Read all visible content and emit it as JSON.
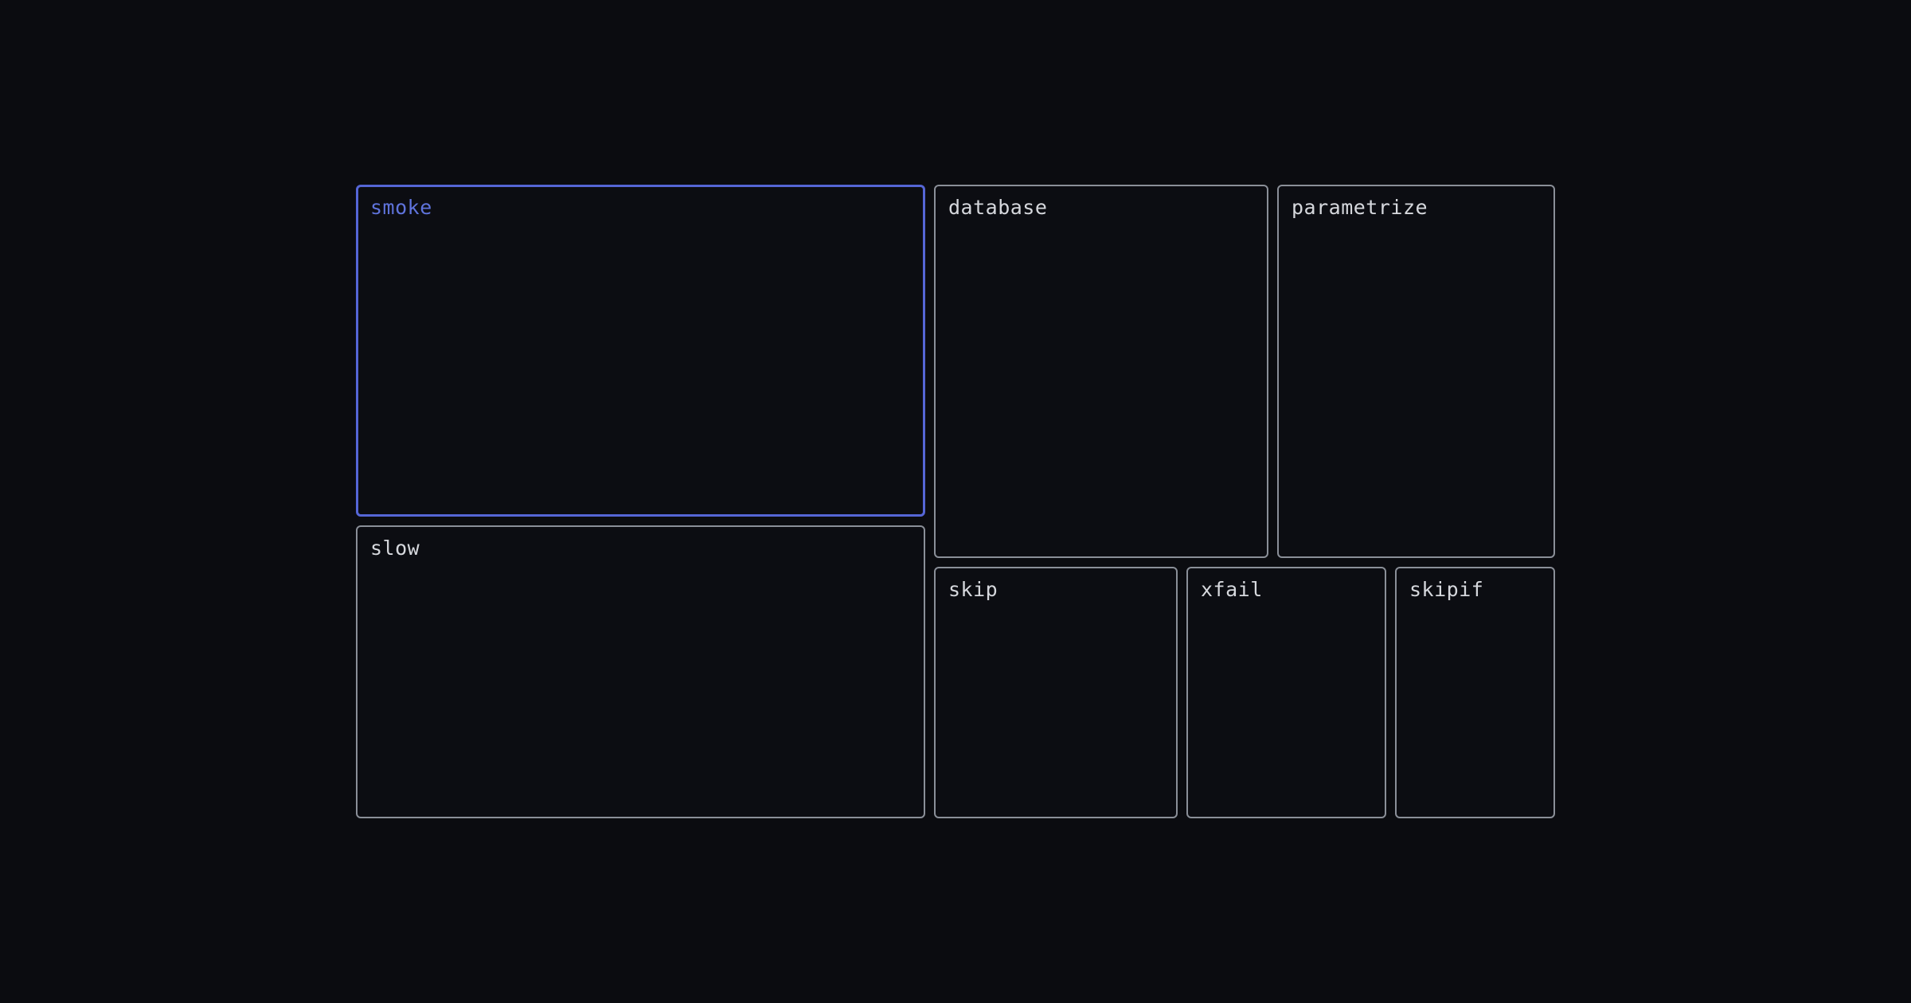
{
  "colors": {
    "background": "#0b0c10",
    "tile_border": "#8a8f98",
    "selected_accent": "#5566d6",
    "label_text": "#d6d8dd"
  },
  "tiles": [
    {
      "key": "smoke",
      "label": "smoke",
      "selected": true
    },
    {
      "key": "slow",
      "label": "slow",
      "selected": false
    },
    {
      "key": "database",
      "label": "database",
      "selected": false
    },
    {
      "key": "parametrize",
      "label": "parametrize",
      "selected": false
    },
    {
      "key": "skip",
      "label": "skip",
      "selected": false
    },
    {
      "key": "xfail",
      "label": "xfail",
      "selected": false
    },
    {
      "key": "skipif",
      "label": "skipif",
      "selected": false
    }
  ]
}
